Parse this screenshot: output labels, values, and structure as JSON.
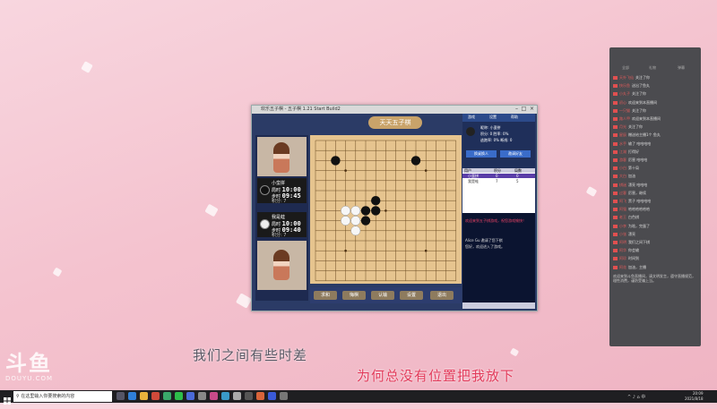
{
  "game_window": {
    "title": "欢乐五子棋 - 五子棋   1.21 Start Build2",
    "board_title": "天天五子棋",
    "player1": {
      "name": "小蛮拼",
      "total_time_label": "局时",
      "total_time": "10:00",
      "step_time_label": "步时",
      "step_time": "09:45",
      "score": "积分: 7"
    },
    "player2": {
      "name": "我是蛙",
      "total_time_label": "局时",
      "total_time": "10:00",
      "step_time_label": "步时",
      "step_time": "09:40",
      "score": "积分: 7"
    },
    "buttons": [
      "求和",
      "悔棋",
      "认输",
      "设置",
      "退出"
    ],
    "stones": {
      "black": [
        [
          2,
          2
        ],
        [
          10,
          2
        ],
        [
          6,
          6
        ],
        [
          5,
          7
        ],
        [
          6,
          7
        ],
        [
          5,
          8
        ]
      ],
      "white": [
        [
          3,
          7
        ],
        [
          4,
          7
        ],
        [
          3,
          8
        ],
        [
          4,
          8
        ],
        [
          4,
          9
        ]
      ]
    },
    "right_pane": {
      "tabs": [
        "游戏",
        "设置",
        "帮助"
      ],
      "info_lines": [
        "昵称: 小蛮拼",
        "积分: 0   胜率: 0%",
        "逃跑率: 0%   断线: 0"
      ],
      "action_buttons": [
        "换桌换人",
        "邀请好友"
      ],
      "list_header": [
        "用户",
        "积分",
        "局数"
      ],
      "list_rows": [
        [
          "小蛮拼",
          "0",
          "0"
        ],
        [
          "我是蛙",
          "7",
          "5"
        ]
      ],
      "chat_lines": [
        "欢迎来到五子棋游戏，祝您游戏愉快！",
        "Alice Gu 邀请了您下棋",
        "您好，欢迎进入了游戏。"
      ]
    }
  },
  "side_panel": {
    "tabs": [
      "全部",
      "礼物",
      "弹幕"
    ],
    "messages": [
      {
        "user": "天外飞仙",
        "text": "关注了你"
      },
      {
        "user": "快乐鱼",
        "text": "送出了鱼丸"
      },
      {
        "user": "小丸子",
        "text": "关注了你"
      },
      {
        "user": "初心",
        "text": "欢迎来到本直播间"
      },
      {
        "user": "一只猫",
        "text": "关注了你"
      },
      {
        "user": "路人甲",
        "text": "欢迎来到本直播间"
      },
      {
        "user": "月光",
        "text": "关注了你"
      },
      {
        "user": "星辰",
        "text": "赠送给主播1个 鱼丸"
      },
      {
        "user": "水手",
        "text": "输了 哈哈哈哈"
      },
      {
        "user": "江湖",
        "text": "打得好"
      },
      {
        "user": "游客",
        "text": "厉害 哈哈哈"
      },
      {
        "user": "小白",
        "text": "第十局"
      },
      {
        "user": "大白",
        "text": "加油"
      },
      {
        "user": "棋迷",
        "text": "漂亮 哈哈哈"
      },
      {
        "user": "过客",
        "text": "厉害，继续"
      },
      {
        "user": "阿飞",
        "text": "黑子 哈哈哈哈"
      },
      {
        "user": "阿强",
        "text": "哈哈哈哈哈哈"
      },
      {
        "user": "老王",
        "text": "白色棋"
      },
      {
        "user": "小李",
        "text": "为啥，完蛋了"
      },
      {
        "user": "小张",
        "text": "漂亮"
      },
      {
        "user": "阿明",
        "text": "我们之间下棋"
      },
      {
        "user": "阿华",
        "text": "你会输"
      },
      {
        "user": "阿珍",
        "text": "时间到"
      },
      {
        "user": "阿花",
        "text": "加油，主播"
      }
    ],
    "footer": "欢迎来到斗鱼直播间，请文明发言，遵守直播规范，理性消费，谨防受骗上当。"
  },
  "subtitles": {
    "line1": "我们之间有些时差",
    "line2": "为何总没有位置把我放下"
  },
  "watermark": {
    "logo_cn": "斗鱼",
    "logo_en": "DOUYU.COM"
  },
  "taskbar": {
    "search_placeholder": "在这里输入你要搜索的内容",
    "time": "20:09",
    "date": "2021/8/18"
  },
  "colors": {
    "subtitle_accent": "#e23a5a",
    "board": "#e6c48f"
  }
}
